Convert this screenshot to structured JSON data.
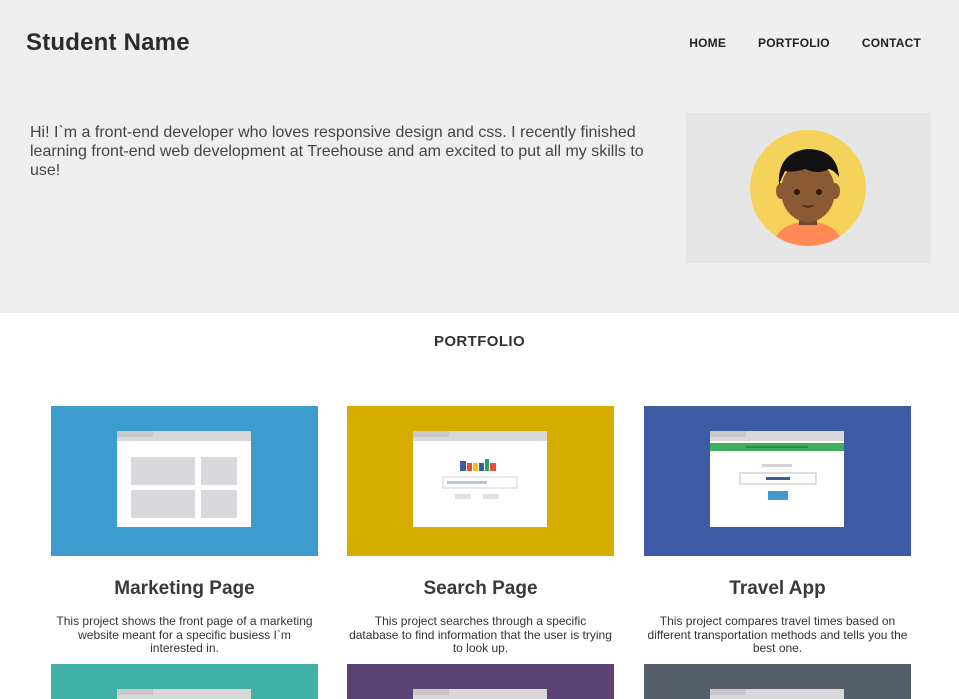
{
  "header": {
    "site_title": "Student Name",
    "nav": [
      {
        "label": "HOME"
      },
      {
        "label": "PORTFOLIO"
      },
      {
        "label": "CONTACT"
      }
    ]
  },
  "intro": {
    "text": "Hi! I`m a front-end developer who loves responsive design and css. I recently finished learning front-end web development at Treehouse and am excited to put all my skills to use!"
  },
  "colors": {
    "hero_bg": "#efefef",
    "blue": "#3d9bce",
    "yellow": "#d4ad00",
    "navy": "#3b5ca4",
    "teal": "#41b1a8",
    "purple": "#5b4475",
    "slate": "#555e6b"
  },
  "portfolio": {
    "title": "PORTFOLIO",
    "projects": [
      {
        "title": "Marketing Page",
        "description": "This project shows the front page of a marketing website meant for a specific busiess I`m interested in.",
        "thumb_color": "#3d9bce"
      },
      {
        "title": "Search Page",
        "description": "This project searches through a specific database to find information that the user is trying to look up.",
        "thumb_color": "#d4ad00"
      },
      {
        "title": "Travel App",
        "description": "This project compares travel times based on different transportation methods and tells you the best one.",
        "thumb_color": "#3b5ca4"
      }
    ],
    "partial_thumbs": [
      {
        "thumb_color": "#41b1a8"
      },
      {
        "thumb_color": "#5b4475"
      },
      {
        "thumb_color": "#555e6b"
      }
    ]
  }
}
